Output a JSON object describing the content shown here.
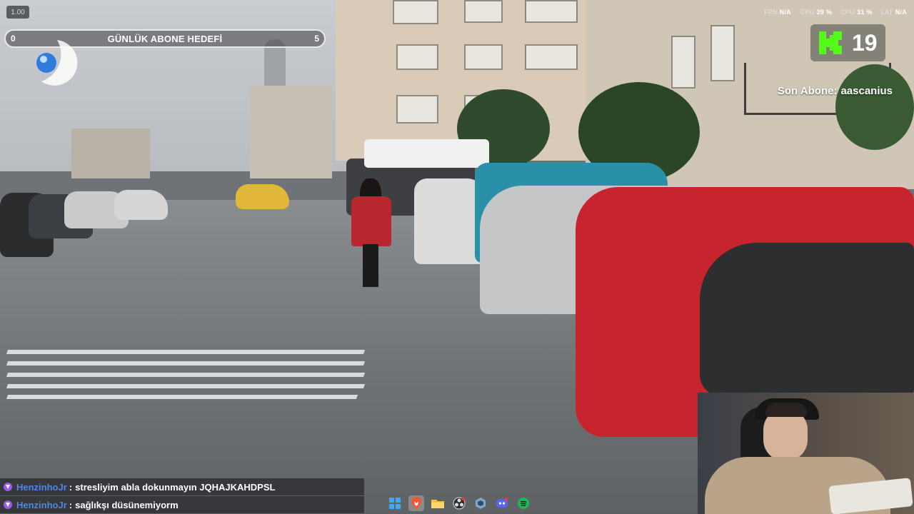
{
  "overlay": {
    "speed": "1.00",
    "goal": {
      "min": "0",
      "title": "GÜNLÜK ABONE HEDEFİ",
      "max": "5"
    },
    "perf": [
      {
        "label": "FPS",
        "value": "N/A"
      },
      {
        "label": "GPU",
        "value": "39 %"
      },
      {
        "label": "CPU",
        "value": "31 %"
      },
      {
        "label": "LAT",
        "value": "N/A"
      }
    ],
    "kick": {
      "count": "19"
    },
    "last_sub": {
      "label": "Son Abone:",
      "name": "aascanius"
    }
  },
  "chat": [
    {
      "user": "HenzinhoJr",
      "sep": ":",
      "message": "stresliyim abla dokunmayın JQHAJKAHDPSL"
    },
    {
      "user": "HenzinhoJr",
      "sep": ":",
      "message": "sağlıkşı düsünemiyorm"
    }
  ],
  "taskbar": {
    "icons": [
      "windows-start-icon",
      "brave-browser-icon",
      "file-explorer-icon",
      "obs-icon",
      "app-icon",
      "discord-icon",
      "spotify-icon"
    ]
  },
  "colors": {
    "kick_green": "#53fc18",
    "chat_user": "#4f86e8",
    "goal_border": "#e8e8e8"
  }
}
